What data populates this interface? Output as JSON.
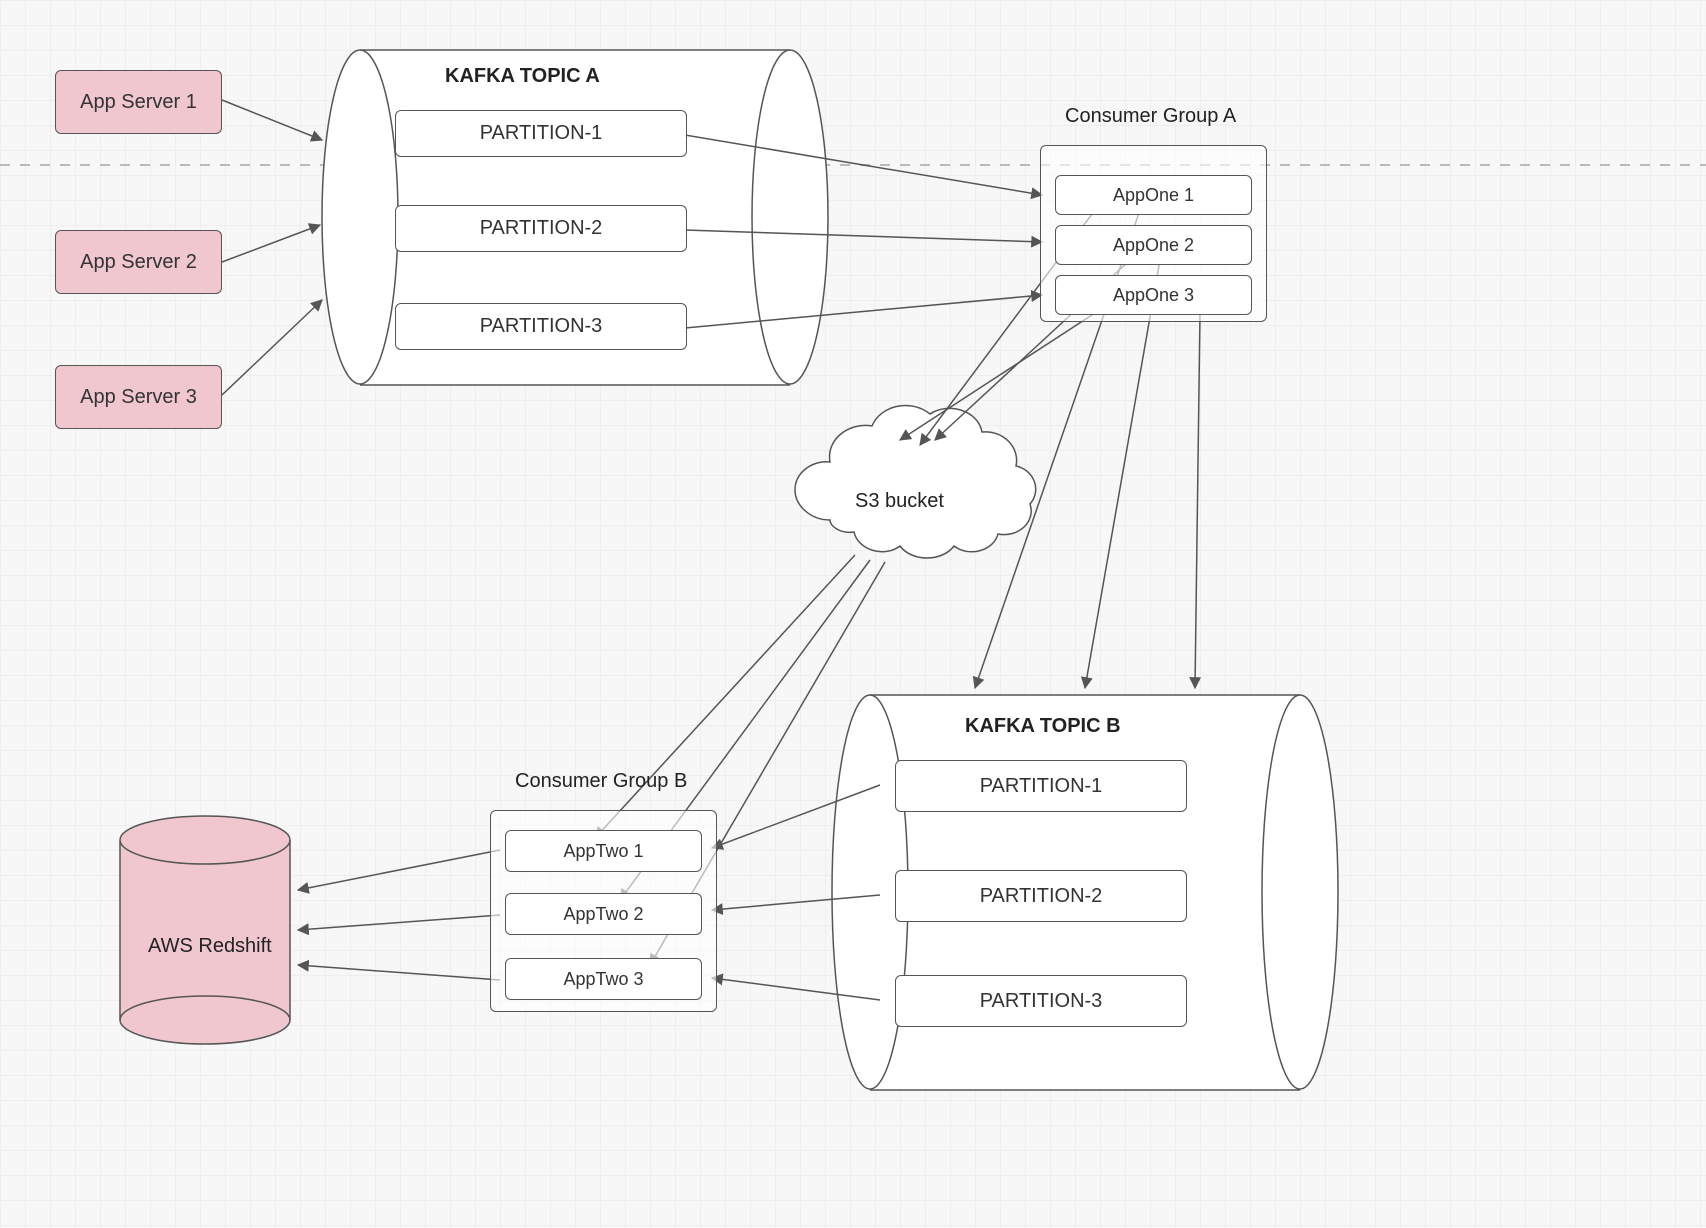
{
  "appServers": [
    "App Server 1",
    "App Server 2",
    "App Server 3"
  ],
  "topicA": {
    "title": "KAFKA TOPIC A",
    "partitions": [
      "PARTITION-1",
      "PARTITION-2",
      "PARTITION-3"
    ]
  },
  "consumerGroupA": {
    "title": "Consumer Group A",
    "apps": [
      "AppOne 1",
      "AppOne 2",
      "AppOne 3"
    ]
  },
  "s3": "S3 bucket",
  "topicB": {
    "title": "KAFKA TOPIC B",
    "partitions": [
      "PARTITION-1",
      "PARTITION-2",
      "PARTITION-3"
    ]
  },
  "consumerGroupB": {
    "title": "Consumer Group B",
    "apps": [
      "AppTwo 1",
      "AppTwo 2",
      "AppTwo 3"
    ]
  },
  "redshift": "AWS Redshift",
  "colors": {
    "pink": "#f0c7cf",
    "stroke": "#555555"
  }
}
